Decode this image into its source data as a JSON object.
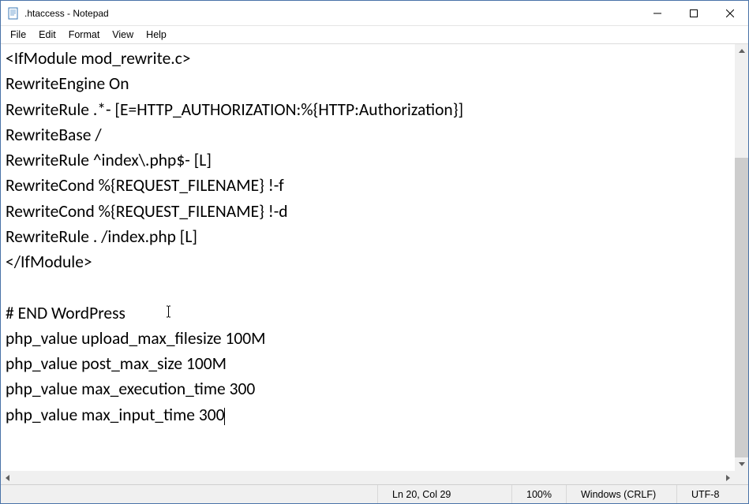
{
  "window": {
    "title": ".htaccess - Notepad"
  },
  "menu": {
    "file": "File",
    "edit": "Edit",
    "format": "Format",
    "view": "View",
    "help": "Help"
  },
  "content": {
    "lines": [
      "<IfModule mod_rewrite.c>",
      "RewriteEngine On",
      "RewriteRule .*- [E=HTTP_AUTHORIZATION:%{HTTP:Authorization}]",
      "RewriteBase /",
      "RewriteRule ^index\\.php$- [L]",
      "RewriteCond %{REQUEST_FILENAME} !-f",
      "RewriteCond %{REQUEST_FILENAME} !-d",
      "RewriteRule . /index.php [L]",
      "</IfModule>",
      "",
      "# END WordPress",
      "php_value upload_max_filesize 100M",
      "php_value post_max_size 100M",
      "php_value max_execution_time 300",
      "php_value max_input_time 300"
    ]
  },
  "status": {
    "position": "Ln 20, Col 29",
    "zoom": "100%",
    "line_ending": "Windows (CRLF)",
    "encoding": "UTF-8"
  },
  "scroll": {
    "thumb_top_pct": 25,
    "thumb_height_pct": 75
  }
}
